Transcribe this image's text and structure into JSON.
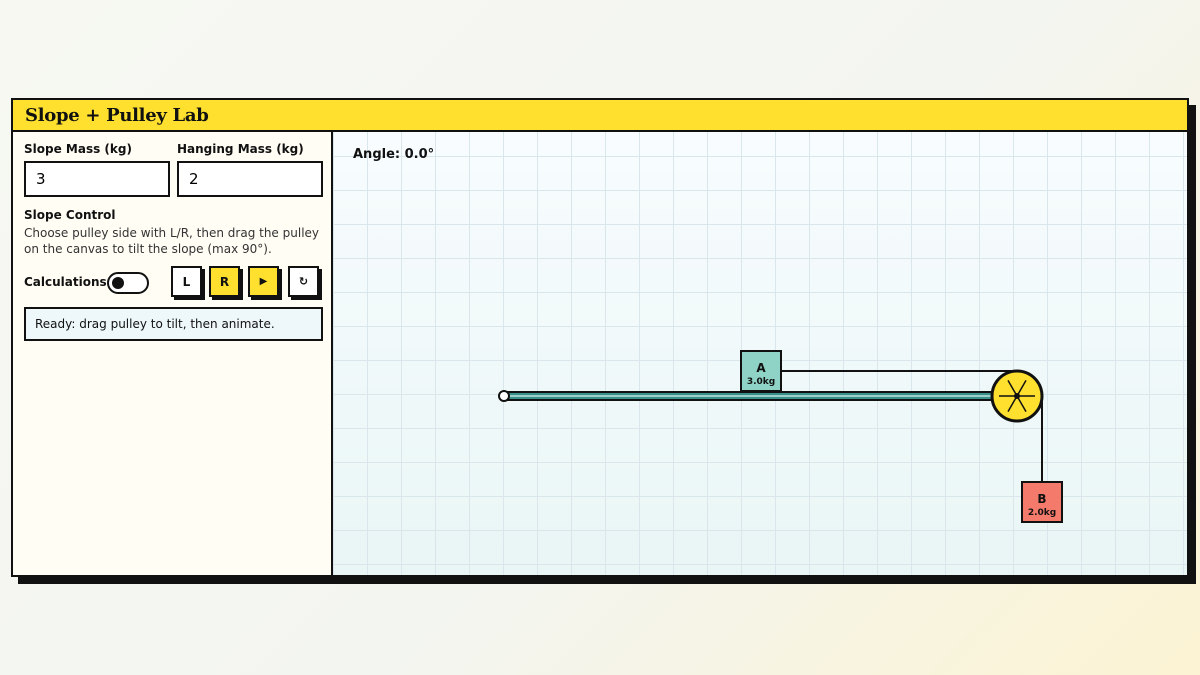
{
  "app": {
    "title": "Slope + Pulley Lab"
  },
  "controls": {
    "slope_mass_label": "Slope Mass (kg)",
    "slope_mass_value": "3",
    "hanging_mass_label": "Hanging Mass (kg)",
    "hanging_mass_value": "2",
    "slope_control_title": "Slope Control",
    "slope_control_help": "Choose pulley side with L/R, then drag the pulley on the canvas to tilt the slope (max 90°).",
    "calculations_label": "Calculations",
    "calculations_on": false,
    "left_label": "L",
    "right_label": "R",
    "play_label": "▶",
    "reset_label": "↻",
    "status": "Ready: drag pulley to tilt, then animate."
  },
  "canvas": {
    "angle_readout": "Angle: 0.0°",
    "block_a": {
      "letter": "A",
      "mass": "3.0kg",
      "color": "#8fd3c7"
    },
    "block_b": {
      "letter": "B",
      "mass": "2.0kg",
      "color": "#f47b6b"
    },
    "pulley_color": "#ffe02e",
    "slope_color": "#3a8f8a"
  },
  "colors": {
    "accent": "#ffe02e",
    "ink": "#111111",
    "panel": "#fffdf4"
  }
}
